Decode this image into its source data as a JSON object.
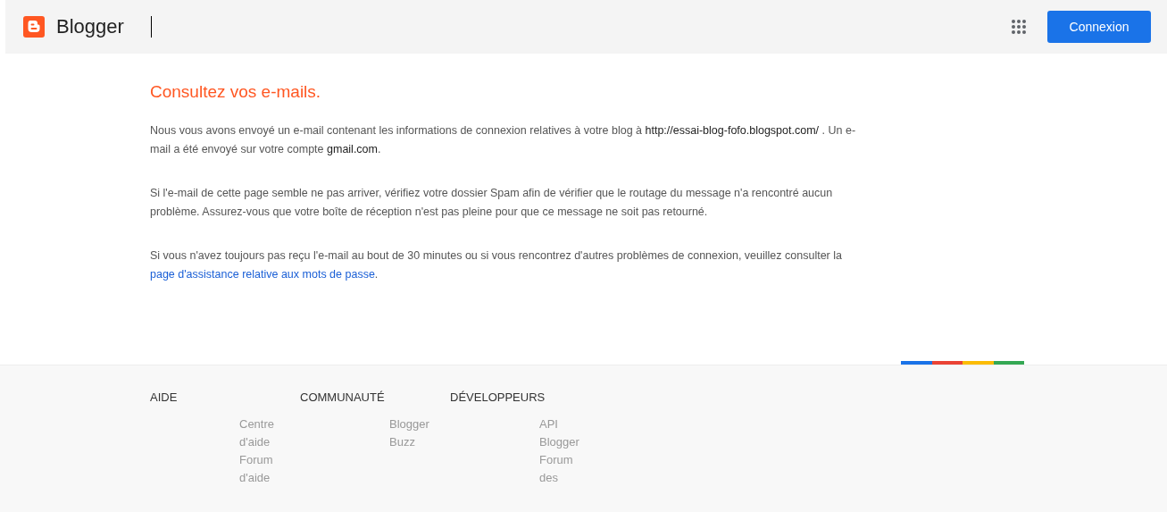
{
  "header": {
    "brand": "Blogger",
    "button": "Connexion"
  },
  "title": "Consultez vos e-mails.",
  "paragraphs": [
    [
      {
        "kind": "plain",
        "text": "Nous vous avons envoyé un e-mail contenant les informations de connexion relatives à votre blog à "
      },
      {
        "kind": "strong",
        "text": "http://essai-blog-fofo.blogspot.com/"
      },
      {
        "kind": "plain",
        "text": " . Un e-mail a été envoyé sur votre compte "
      },
      {
        "kind": "strong",
        "text": "gmail.com"
      },
      {
        "kind": "plain",
        "text": "."
      }
    ],
    [
      {
        "kind": "plain",
        "text": "Si l'e-mail de cette page semble ne pas arriver, vérifiez votre dossier Spam afin de vérifier que le routage du message n'a rencontré aucun problème. Assurez-vous que votre boîte de réception n'est pas pleine pour que ce message ne soit pas retourné."
      }
    ],
    [
      {
        "kind": "plain",
        "text": "Si vous n'avez toujours pas reçu l'e-mail au bout de 30 minutes ou si vous rencontrez d'autres problèmes de connexion, veuillez consulter la "
      },
      {
        "kind": "link",
        "text": "page d'assistance relative aux mots de passe"
      },
      {
        "kind": "plain",
        "text": "."
      }
    ]
  ],
  "footer": {
    "columns": [
      {
        "heading": "AIDE",
        "links": [
          "Centre d'aide",
          "Forum d'aide"
        ]
      },
      {
        "heading": "COMMUNAUTÉ",
        "links": [
          "Blogger Buzz"
        ]
      },
      {
        "heading": "DÉVELOPPEURS",
        "links": [
          "API Blogger",
          "Forum des"
        ]
      }
    ]
  }
}
